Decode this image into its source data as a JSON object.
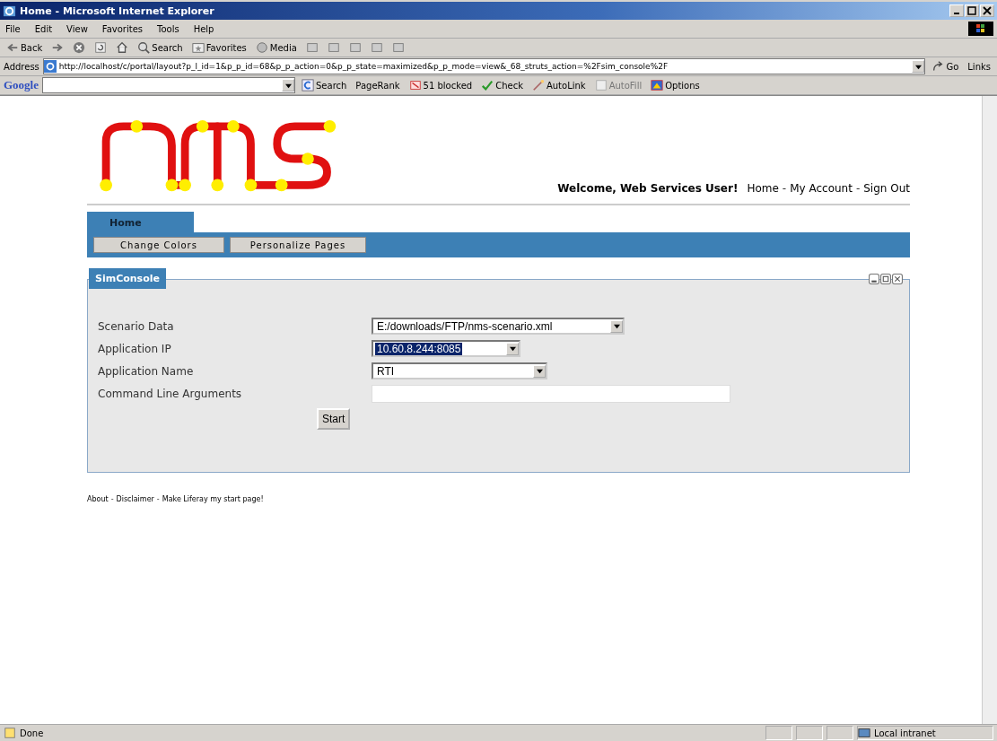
{
  "window": {
    "title": "Home - Microsoft Internet Explorer"
  },
  "menu": [
    "File",
    "Edit",
    "View",
    "Favorites",
    "Tools",
    "Help"
  ],
  "toolbar": [
    {
      "kind": "back",
      "label": "Back"
    },
    {
      "kind": "forward"
    },
    {
      "kind": "stop"
    },
    {
      "kind": "refresh"
    },
    {
      "kind": "home"
    },
    {
      "kind": "search",
      "label": "Search"
    },
    {
      "kind": "favorites",
      "label": "Favorites"
    },
    {
      "kind": "media",
      "label": "Media"
    },
    {
      "kind": "history"
    },
    {
      "kind": "mail"
    },
    {
      "kind": "print"
    },
    {
      "kind": "edit"
    },
    {
      "kind": "discuss"
    }
  ],
  "address": {
    "label": "Address",
    "url": "http://localhost/c/portal/layout?p_l_id=1&p_p_id=68&p_p_action=0&p_p_state=maximized&p_p_mode=view&_68_struts_action=%2Fsim_console%2F",
    "go": "Go",
    "links": "Links"
  },
  "google_bar": {
    "logo": "Google",
    "items": [
      {
        "kind": "search",
        "label": "Search",
        "disabled": false
      },
      {
        "kind": "pagerank",
        "label": "PageRank",
        "disabled": false
      },
      {
        "kind": "blocked",
        "label": "51 blocked",
        "disabled": false
      },
      {
        "kind": "check",
        "label": "Check",
        "disabled": false
      },
      {
        "kind": "autolink",
        "label": "AutoLink",
        "disabled": false
      },
      {
        "kind": "autofill",
        "label": "AutoFill",
        "disabled": true
      },
      {
        "kind": "options",
        "label": "Options",
        "disabled": false
      }
    ]
  },
  "header": {
    "welcome": "Welcome, Web Services User!",
    "links": [
      "Home",
      "My Account",
      "Sign Out"
    ],
    "separator": "-"
  },
  "tabs": [
    {
      "label": "Home",
      "selected": true
    }
  ],
  "nav_buttons": [
    "Change Colors",
    "Personalize Pages"
  ],
  "portlet": {
    "title": "SimConsole",
    "fields": [
      {
        "kind": "select",
        "label": "Scenario Data",
        "value": "E:/downloads/FTP/nms-scenario.xml",
        "highlighted": false
      },
      {
        "kind": "select",
        "label": "Application IP",
        "value": "10.60.8.244:8085",
        "highlighted": true
      },
      {
        "kind": "select",
        "label": "Application Name",
        "value": "RTI",
        "highlighted": false
      },
      {
        "kind": "text",
        "label": "Command Line Arguments"
      }
    ],
    "button": "Start"
  },
  "footer": {
    "links": [
      "About",
      "Disclaimer",
      "Make Liferay my start page!"
    ],
    "separator": "-"
  },
  "status": {
    "text": "Done",
    "zone": "Local intranet"
  }
}
